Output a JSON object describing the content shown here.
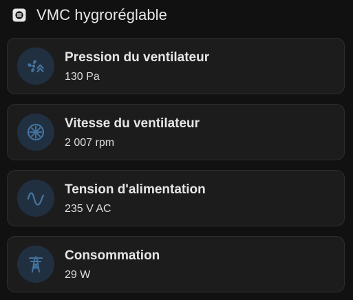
{
  "header": {
    "title": "VMC hygroréglable",
    "icon": "ventilation-icon"
  },
  "colors": {
    "background": "#111111",
    "card": "#1c1c1c",
    "icon_badge": "#213040",
    "icon": "#44739e"
  },
  "entities": [
    {
      "name": "Pression du ventilateur",
      "state": "130 Pa",
      "icon": "fan-pressure-icon"
    },
    {
      "name": "Vitesse du ventilateur",
      "state": "2 007 rpm",
      "icon": "fan-speed-icon"
    },
    {
      "name": "Tension d'alimentation",
      "state": "235 V AC",
      "icon": "sine-wave-icon"
    },
    {
      "name": "Consommation",
      "state": "29 W",
      "icon": "transmission-tower-icon"
    }
  ]
}
